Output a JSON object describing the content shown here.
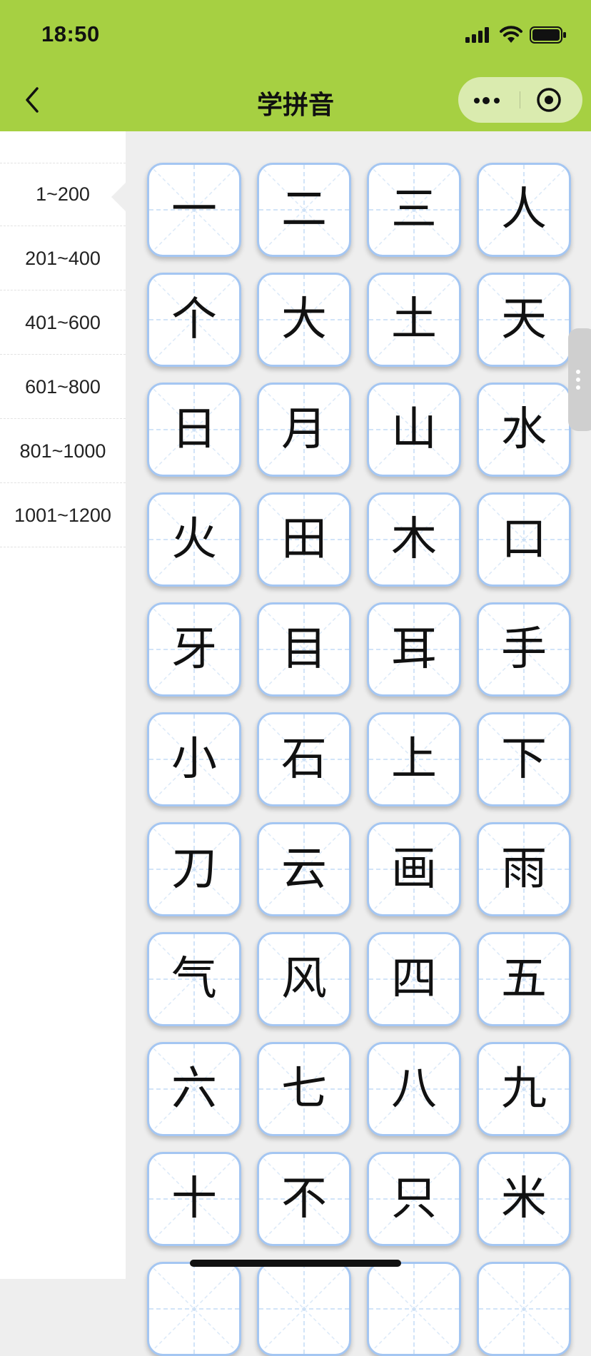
{
  "status_bar": {
    "time": "18:50"
  },
  "nav": {
    "title": "学拼音"
  },
  "sidebar": {
    "ranges": [
      {
        "label": "1~200",
        "active": true
      },
      {
        "label": "201~400",
        "active": false
      },
      {
        "label": "401~600",
        "active": false
      },
      {
        "label": "601~800",
        "active": false
      },
      {
        "label": "801~1000",
        "active": false
      },
      {
        "label": "1001~1200",
        "active": false
      }
    ]
  },
  "characters": [
    "一",
    "二",
    "三",
    "人",
    "个",
    "大",
    "土",
    "天",
    "日",
    "月",
    "山",
    "水",
    "火",
    "田",
    "木",
    "口",
    "牙",
    "目",
    "耳",
    "手",
    "小",
    "石",
    "上",
    "下",
    "刀",
    "云",
    "画",
    "雨",
    "气",
    "风",
    "四",
    "五",
    "六",
    "七",
    "八",
    "九",
    "十",
    "不",
    "只",
    "米"
  ],
  "colors": {
    "header": "#a6d042",
    "card_border": "#a4c6f2",
    "grid_line": "#c3dbf5",
    "background": "#eeeeee"
  }
}
